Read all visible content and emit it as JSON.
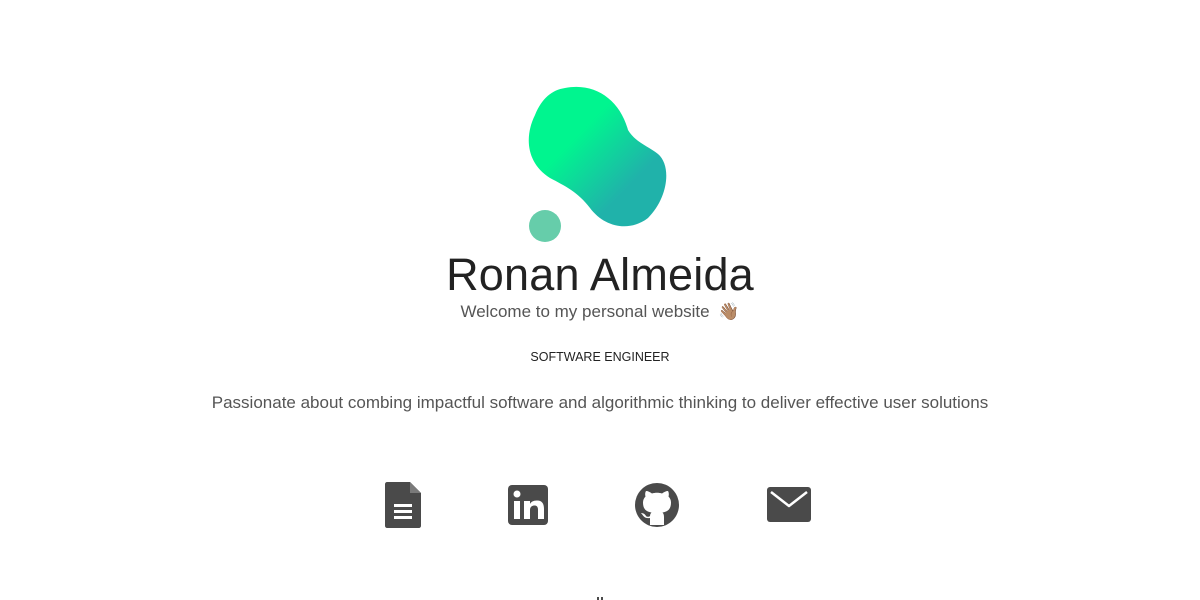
{
  "profile": {
    "name": "Ronan Almeida",
    "welcome": "Welcome to my personal website",
    "welcome_emoji": "👋🏽",
    "role": "SOFTWARE ENGINEER",
    "tagline": "Passionate about combing impactful software and algorithmic thinking to deliver effective user solutions"
  },
  "logo": {
    "gradient_start": "#00F58F",
    "gradient_end": "#20B2AA",
    "dot_color": "#66CDAA"
  },
  "social_links": [
    {
      "name": "resume",
      "icon": "document-icon"
    },
    {
      "name": "linkedin",
      "icon": "linkedin-icon"
    },
    {
      "name": "github",
      "icon": "github-icon"
    },
    {
      "name": "email",
      "icon": "envelope-icon"
    }
  ],
  "colors": {
    "icon": "#4A4A4A",
    "heading": "#222222",
    "body_text": "#555555"
  }
}
